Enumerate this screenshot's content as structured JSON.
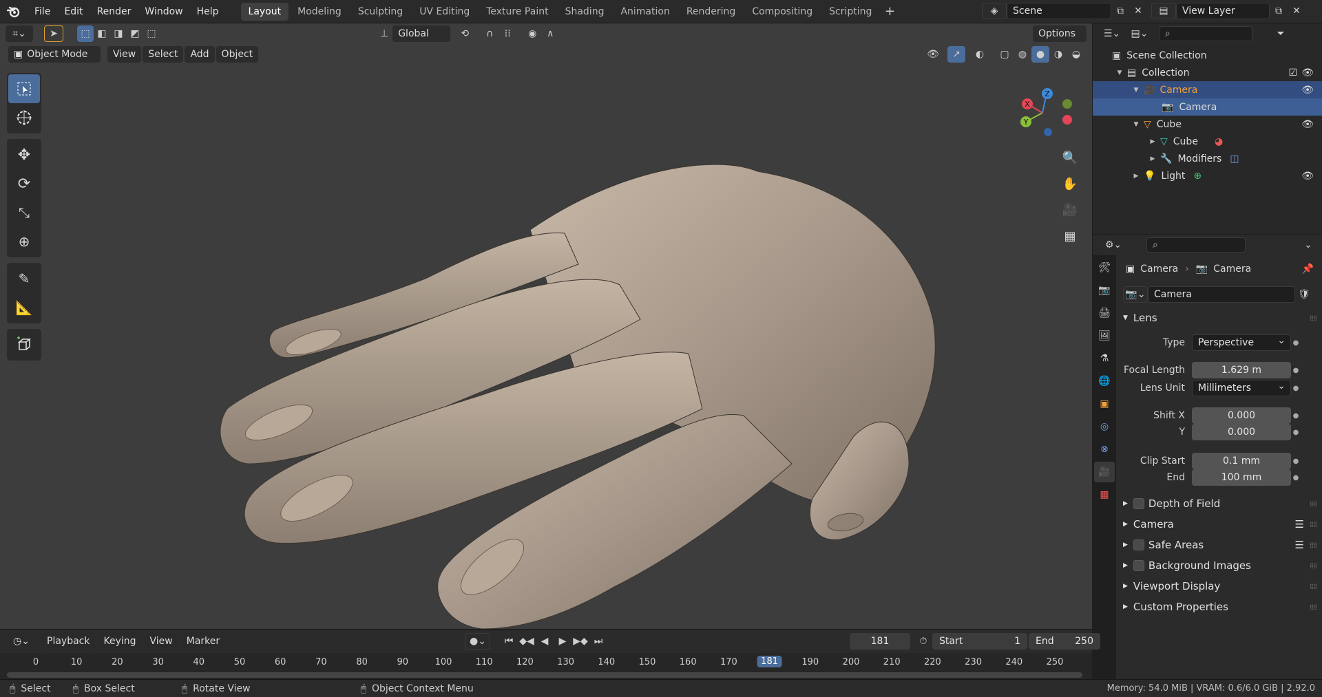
{
  "menus": [
    "File",
    "Edit",
    "Render",
    "Window",
    "Help"
  ],
  "workspaces": [
    "Layout",
    "Modeling",
    "Sculpting",
    "UV Editing",
    "Texture Paint",
    "Shading",
    "Animation",
    "Rendering",
    "Compositing",
    "Scripting"
  ],
  "scene": "Scene",
  "view_layer": "View Layer",
  "viewport": {
    "transform_orientation": "Global",
    "options_label": "Options",
    "mode": "Object Mode",
    "header_menus": [
      "View",
      "Select",
      "Add",
      "Object"
    ],
    "gizmo": {
      "x": "X",
      "y": "Y",
      "z": "Z"
    }
  },
  "outliner": {
    "search_placeholder": "",
    "rows": [
      {
        "label": "Scene Collection"
      },
      {
        "label": "Collection"
      },
      {
        "label": "Camera"
      },
      {
        "label": "Camera"
      },
      {
        "label": "Cube"
      },
      {
        "label": "Cube"
      },
      {
        "label": "Modifiers"
      },
      {
        "label": "Light"
      }
    ]
  },
  "properties": {
    "breadcrumb": [
      "Camera",
      "Camera"
    ],
    "datablock": "Camera",
    "lens_panel": "Lens",
    "type_label": "Type",
    "type_value": "Perspective",
    "focal_label": "Focal Length",
    "focal_value": "1.629 m",
    "lens_unit_label": "Lens Unit",
    "lens_unit_value": "Millimeters",
    "shift_x_label": "Shift X",
    "shift_x_value": "0.000",
    "shift_y_label": "Y",
    "shift_y_value": "0.000",
    "clip_start_label": "Clip Start",
    "clip_start_value": "0.1 mm",
    "clip_end_label": "End",
    "clip_end_value": "100 mm",
    "panels": [
      "Depth of Field",
      "Camera",
      "Safe Areas",
      "Background Images",
      "Viewport Display",
      "Custom Properties"
    ]
  },
  "timeline": {
    "menus": [
      "Playback",
      "Keying",
      "View",
      "Marker"
    ],
    "current_frame": "181",
    "start_label": "Start",
    "start_value": "1",
    "end_label": "End",
    "end_value": "250",
    "ticks": [
      "0",
      "10",
      "20",
      "30",
      "40",
      "50",
      "60",
      "70",
      "80",
      "90",
      "100",
      "110",
      "120",
      "130",
      "140",
      "150",
      "160",
      "170",
      "181",
      "190",
      "200",
      "210",
      "220",
      "230",
      "240",
      "250"
    ]
  },
  "statusbar": {
    "select": "Select",
    "box_select": "Box Select",
    "rotate_view": "Rotate View",
    "context_menu": "Object Context Menu",
    "memory": "Memory: 54.0 MiB | VRAM: 0.6/6.0 GiB | 2.92.0"
  },
  "colors": {
    "accent": "#4b6d9c",
    "selected_row": "#334d80",
    "camera_orange": "#f2a03a",
    "mesh_teal": "#3fc4b0",
    "viewport_bg": "#3d3d3d",
    "hand": "#a89a8a"
  }
}
